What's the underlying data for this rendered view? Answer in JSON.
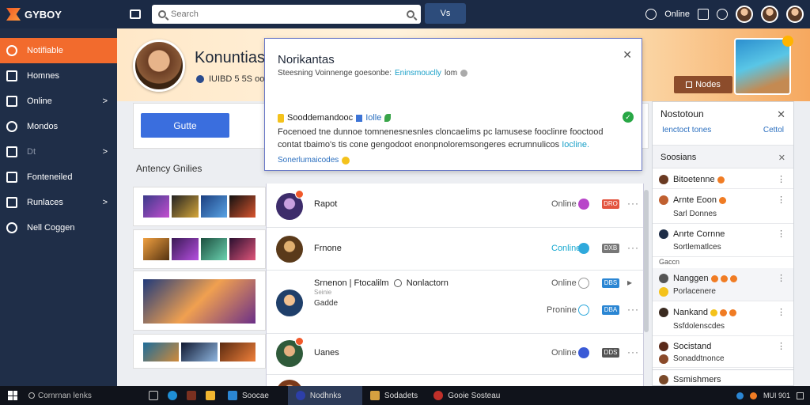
{
  "brand": {
    "name": "GYBOY"
  },
  "search": {
    "placeholder": "Search"
  },
  "topbar": {
    "dropdown_label": "Vs",
    "notifications_label": "Online"
  },
  "sidebar": {
    "items": [
      {
        "label": "Notifiable",
        "active": true
      },
      {
        "label": "Homnes"
      },
      {
        "label": "Online",
        "arrow": ">"
      },
      {
        "label": "Mondos"
      },
      {
        "label": "Dt",
        "arrow": ">"
      },
      {
        "label": "Fonteneiled"
      },
      {
        "label": "Runlaces",
        "arrow": ">"
      },
      {
        "label": "Nell Coggen"
      }
    ]
  },
  "profile": {
    "name": "Konuntias",
    "meta": "IUIBD 5 5S ooo"
  },
  "banner": {
    "button_label": "Nodes"
  },
  "main": {
    "primary_button": "Gutte",
    "activity_title": "Antency Gnilies"
  },
  "notification": {
    "title": "Norikantas",
    "subtitle": "Steesning Voinnenge goesonbe:",
    "subtitle_link": "Eninsmouclly",
    "subtitle_end": "lom",
    "item_title": "Sooddemandooc",
    "item_tag": "Iolle",
    "body": "Focenoed tne dunnoe tomnenesnesnles cloncaelims pc lamusese fooclinre fooctood contat tbaimo's tis cone gengodoot enonpnoloremsongeres ecrumnulicos",
    "body_link": "Iocline.",
    "footer": "Sonerlumaicodes"
  },
  "friends": [
    {
      "name": "Rapot",
      "status": "Online",
      "status_color": "plain",
      "dot": "#b845c9",
      "tag": "DRO",
      "tag_color": "#e35540"
    },
    {
      "name": "Frnone",
      "status": "Conline",
      "status_color": "cyan",
      "dot": "#2fa9dc",
      "tag": "DXB",
      "tag_color": "#777"
    },
    {
      "name": "Srnenon | Ftocalilm",
      "name_extra": "Nonlactorn",
      "status": "Online",
      "dot": "#999",
      "tag": "DBS",
      "tag_color": "#2b86d3",
      "sub": "Seinie",
      "sub2": "Gadde",
      "status2": "Pronine",
      "tag2": "DBA",
      "tag2_color": "#2b86d3"
    },
    {
      "name": "Uanes",
      "status": "Online",
      "status_color": "plain",
      "dot": "#3a5ad6",
      "tag": "DDS",
      "tag_color": "#555"
    }
  ],
  "right_panel": {
    "title": "Nostotoun",
    "link_left": "Ienctoct tones",
    "link_right": "Cettol",
    "section": "Soosians",
    "rows": [
      {
        "name": "Bitoetenne"
      },
      {
        "name": "Arnte Eoon",
        "sub": "Sarl Donnes"
      },
      {
        "name": "Anrte Cornne",
        "sub": "Sortlematlces"
      },
      {
        "small": "Gaccn"
      },
      {
        "name": "Nanggen",
        "sub": "Porlacenere"
      },
      {
        "name": "Nankand",
        "sub": "Ssfdolenscdes"
      },
      {
        "name": "Socistand",
        "sub": "Sonaddtnonce"
      },
      {
        "name": "Ssmishmers"
      }
    ]
  },
  "taskbar": {
    "search": "Cornrnan lenks",
    "apps": [
      {
        "label": "Soocae"
      },
      {
        "label": "Nodhnks",
        "active": true
      },
      {
        "label": "Sodadets"
      },
      {
        "label": "Gooie Sosteau"
      }
    ],
    "tray": "MUI 901"
  },
  "colors": {
    "accent": "#f26b2d",
    "sidebar": "#1f2e48",
    "topbar": "#1b2a45",
    "primary": "#3a6ede"
  }
}
